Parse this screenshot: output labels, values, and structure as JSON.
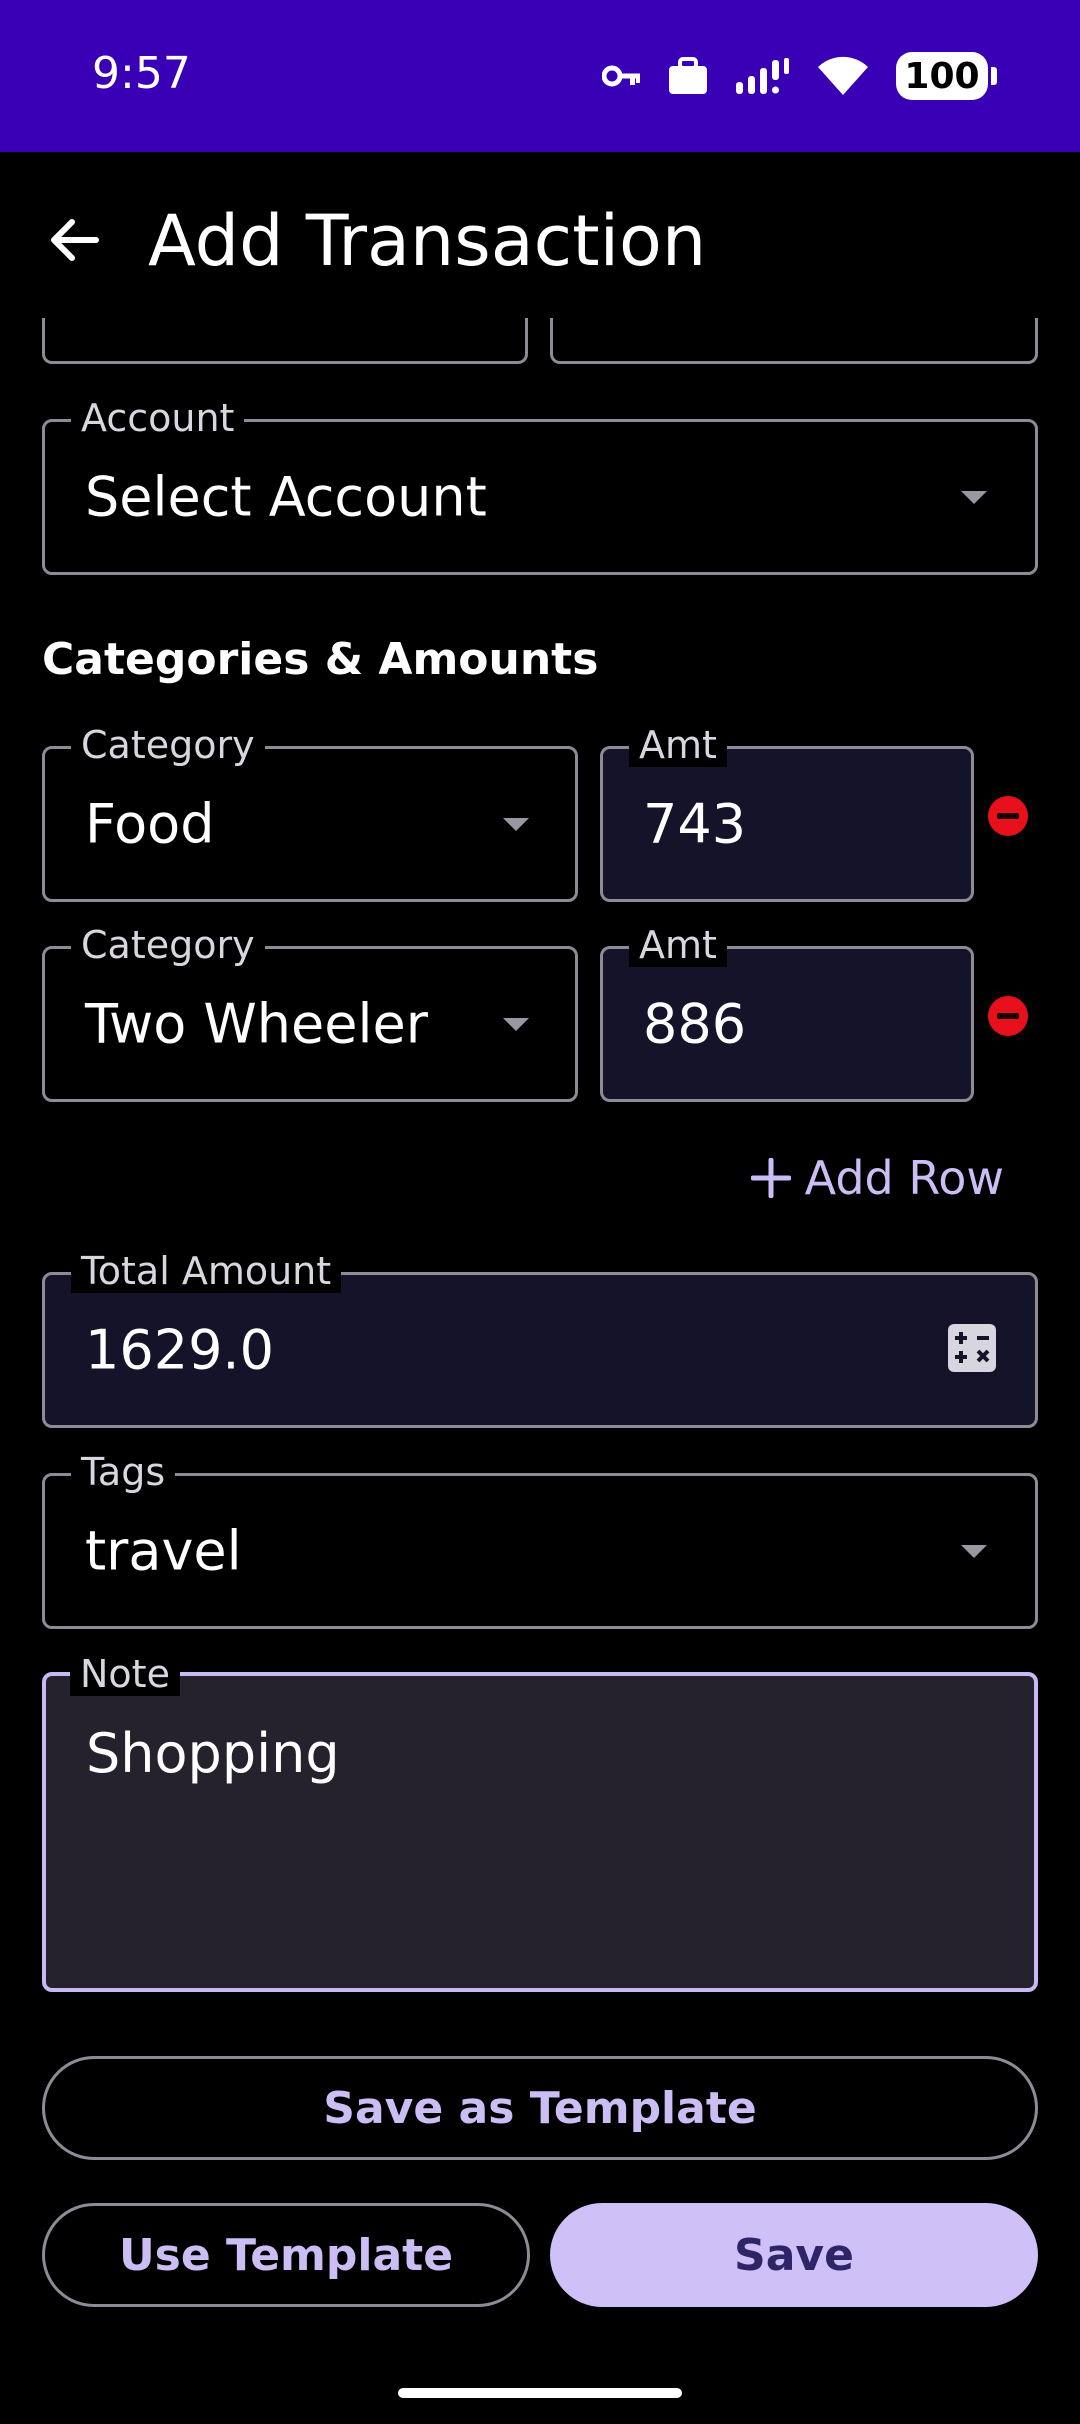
{
  "status_bar": {
    "time": "9:57",
    "battery": "100",
    "icons": [
      "key-icon",
      "briefcase-icon",
      "signal-icon",
      "wifi-icon",
      "battery-icon"
    ]
  },
  "app_bar": {
    "title": "Add Transaction",
    "back_icon": "arrow-back-icon"
  },
  "form": {
    "account": {
      "label": "Account",
      "value": "Select Account"
    },
    "section_title": "Categories & Amounts",
    "rows": [
      {
        "category_label": "Category",
        "category": "Food",
        "amount_label": "Amt",
        "amount": "743"
      },
      {
        "category_label": "Category",
        "category": "Two Wheeler",
        "amount_label": "Amt",
        "amount": "886"
      }
    ],
    "add_row_label": "Add Row",
    "total": {
      "label": "Total Amount",
      "value": "1629.0"
    },
    "tags": {
      "label": "Tags",
      "value": "travel"
    },
    "note": {
      "label": "Note",
      "value": "Shopping"
    }
  },
  "buttons": {
    "save_template": "Save as Template",
    "use_template": "Use Template",
    "save": "Save"
  },
  "colors": {
    "status_bar": "#3a00b5",
    "accent": "#cfc0f8",
    "remove": "#e8101a"
  }
}
